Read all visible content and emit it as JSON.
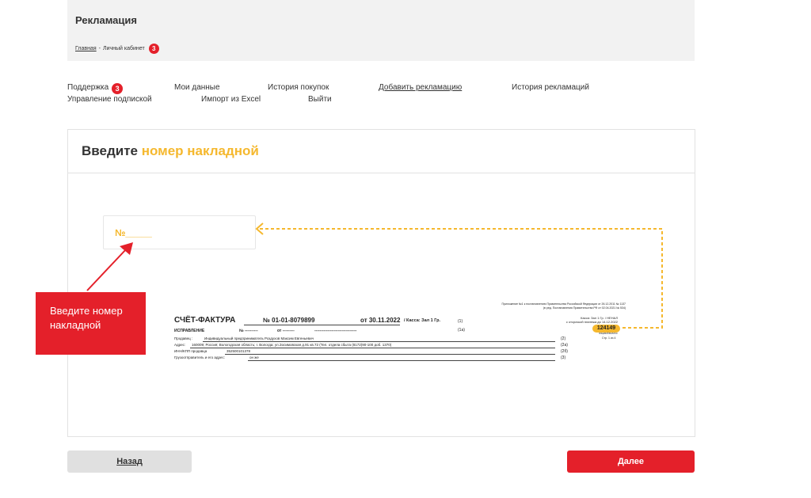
{
  "header": {
    "title": "Рекламация",
    "breadcrumb": {
      "home": "Главная",
      "separator": "-",
      "current": "Личный кабинет",
      "badge": "3"
    }
  },
  "nav": {
    "support": "Поддержка",
    "support_badge": "3",
    "my_data": "Мои данные",
    "purchase_history": "История покупок",
    "add_claim": "Добавить рекламацию",
    "claim_history": "История рекламаций",
    "subscription": "Управление подпиской",
    "import_excel": "Импорт из Excel",
    "logout": "Выйти"
  },
  "card": {
    "title_main": "Введите",
    "title_accent": "номер накладной",
    "input_example": "№_____",
    "tooltip": "Введите номер накладной"
  },
  "invoice": {
    "note_line1": "Приложение №1 к постановлению Правительства Российской Федерации от 26.12.2011 № 1137",
    "note_line2": "(в ред. Постановления Правительства РФ от 02.04.2021 № 534)",
    "title": "СЧЁТ-ФАКТУРА",
    "number": "№ 01-01-8079899",
    "date": "от 30.11.2022",
    "kassa": "/  Касса: Зал 1 Гр.",
    "code1": "(1)",
    "correction_label": "ИСПРАВЛЕНИЕ",
    "correction_number": "№ ----------",
    "correction_date": "от ---------",
    "correction_line": "--------------------------------",
    "code1a": "(1а)",
    "seller_label": "Продавец :",
    "seller_value": "Индивидуальный предприниматель Роздухов Максим Евгеньевич",
    "code2": "(2)",
    "address_label": "Адрес:",
    "address_value": "160009; Россия; Вологодская область; г. Вологда; ул.Зосимовская д.91 кв.72 (Тел. отдела сбыта (8172)90-100 доб. 1370)",
    "code2a": "(2а)",
    "inn_label": "ИНН/КПП продавца",
    "inn_value": "352500101378",
    "code2b": "(2б)",
    "shipper_label": "Грузоотправитель и его адрес:",
    "shipper_value": "он же",
    "code3": "(3)",
    "kassa_right_line1": "Касса: Зал 1 Гр. / НЕНАЛ",
    "kassa_right_line2": "с отсрочкой платежа до 14.12.2022",
    "highlight_number": "124149",
    "highlight_sub": "ЛИЦЕВОЙ/ВИЛИСЯ",
    "page": "Стр. 1 из 4"
  },
  "buttons": {
    "back": "Назад",
    "next": "Далее"
  },
  "colors": {
    "accent_yellow": "#f5b82e",
    "brand_red": "#e4202a",
    "header_bg": "#f2f2f2",
    "back_button_bg": "#e0e0e0"
  }
}
